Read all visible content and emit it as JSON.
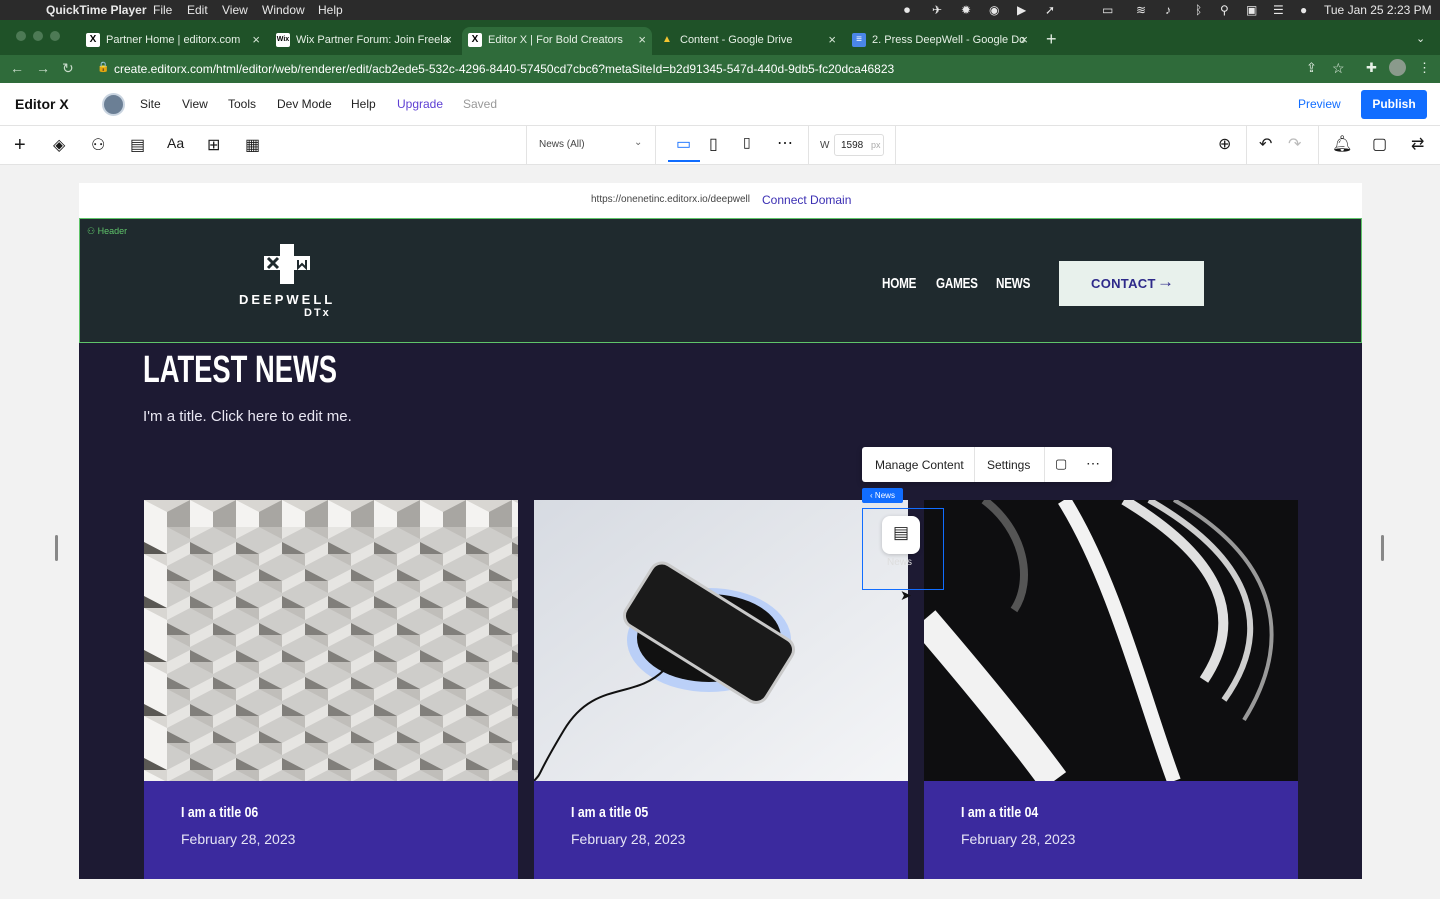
{
  "menubar": {
    "app": "QuickTime Player",
    "items": [
      "File",
      "Edit",
      "View",
      "Window",
      "Help"
    ],
    "clock": "Tue Jan 25  2:23 PM"
  },
  "tabs": [
    {
      "label": "Partner Home | editorx.com",
      "favicon": "X"
    },
    {
      "label": "Wix Partner Forum: Join Freela",
      "favicon": "Wix"
    },
    {
      "label": "Editor X | For Bold Creators",
      "favicon": "X"
    },
    {
      "label": "Content - Google Drive",
      "favicon": "drive-icon"
    },
    {
      "label": "2. Press DeepWell - Google Do",
      "favicon": "docs-icon"
    }
  ],
  "url": "create.editorx.com/html/editor/web/renderer/edit/acb2ede5-532c-4296-8440-57450cd7cbc6?metaSiteId=b2d91345-547d-440d-9db5-fc20dca46823",
  "editor": {
    "logo": "Editor X",
    "menu": [
      "Site",
      "View",
      "Tools",
      "Dev Mode",
      "Help"
    ],
    "upgrade": "Upgrade",
    "saved": "Saved",
    "preview": "Preview",
    "publish": "Publish"
  },
  "toolbar": {
    "page_select": "News (All)",
    "width_label": "W",
    "width_value": "1598",
    "width_unit": "px"
  },
  "canvas": {
    "site_url": "https://onenetinc.editorx.io/deepwell",
    "connect_domain": "Connect Domain",
    "header_tag": "Header",
    "logo_line1": "DEEPWELL",
    "logo_line2": "DTx",
    "nav": [
      "HOME",
      "GAMES",
      "NEWS"
    ],
    "contact": "CONTACT",
    "section_title": "LATEST NEWS",
    "section_subtitle": "I'm a title. Click here to edit me.",
    "context_menu": {
      "manage": "Manage Content",
      "settings": "Settings"
    },
    "news_tag": "‹ News",
    "news_label": "News",
    "cards": [
      {
        "title": "I am a title 06",
        "date": "February 28, 2023"
      },
      {
        "title": "I am a title 05",
        "date": "February 28, 2023"
      },
      {
        "title": "I am a title 04",
        "date": "February 28, 2023"
      }
    ]
  },
  "colors": {
    "browser_green": "#1f5228",
    "publish_blue": "#116dff",
    "site_header_bg": "#1f2a2e",
    "site_body_bg": "#1d1a33",
    "card_bg": "#3b2a9e",
    "contact_bg": "#e8f1ec",
    "selection_green": "#5fc46a"
  }
}
